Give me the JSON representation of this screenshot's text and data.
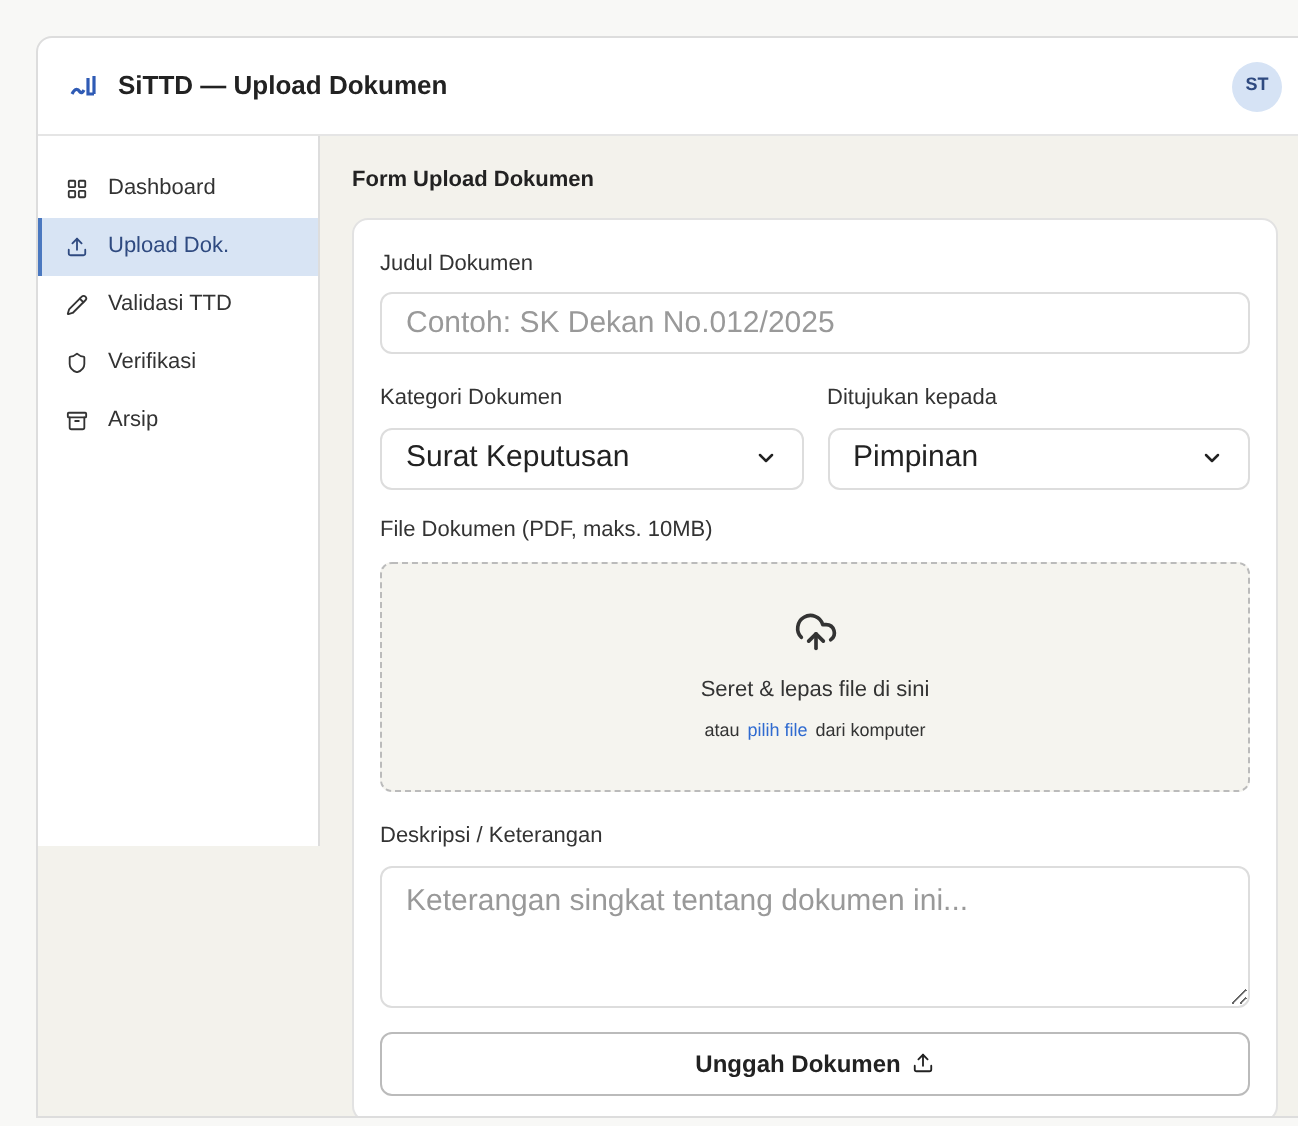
{
  "header": {
    "title": "SiTTD — Upload Dokumen",
    "avatar": "ST"
  },
  "sidebar": {
    "items": [
      {
        "label": "Dashboard",
        "selected": false
      },
      {
        "label": "Upload Dok.",
        "selected": true
      },
      {
        "label": "Validasi TTD",
        "selected": false
      },
      {
        "label": "Verifikasi",
        "selected": false
      },
      {
        "label": "Arsip",
        "selected": false
      }
    ]
  },
  "form": {
    "title": "Form Upload Dokumen",
    "title_field": {
      "label": "Judul Dokumen",
      "placeholder": "Contoh: SK Dekan No.012/2025"
    },
    "category": {
      "label": "Kategori Dokumen",
      "value": "Surat Keputusan"
    },
    "recipient": {
      "label": "Ditujukan kepada",
      "value": "Pimpinan"
    },
    "file": {
      "label": "File Dokumen (PDF, maks. 10MB)",
      "drop_text": "Seret & lepas file di sini",
      "hint_before": "atau",
      "link": "pilih file",
      "hint_after": "dari komputer"
    },
    "description": {
      "label": "Deskripsi / Keterangan",
      "placeholder": "Keterangan singkat tentang dokumen ini..."
    },
    "submit": "Unggah Dokumen"
  }
}
